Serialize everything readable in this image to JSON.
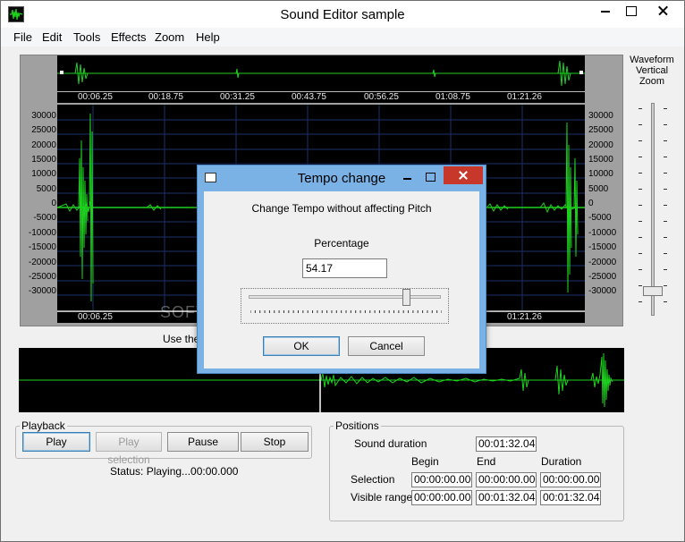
{
  "window": {
    "title": "Sound Editor sample",
    "icon": "waveform-icon"
  },
  "menu": [
    "File",
    "Edit",
    "Tools",
    "Effects",
    "Zoom",
    "Help"
  ],
  "ruler": [
    "00:06.25",
    "00:18.75",
    "00:31.25",
    "00:43.75",
    "00:56.25",
    "01:08.75",
    "01:21.26"
  ],
  "y_axis": [
    "30000",
    "25000",
    "20000",
    "15000",
    "10000",
    "5000",
    "0",
    "-5000",
    "-10000",
    "-15000",
    "-20000",
    "-25000",
    "-30000"
  ],
  "zoom": {
    "label_line1": "Waveform",
    "label_line2": "Vertical",
    "label_line3": "Zoom"
  },
  "hint_text": "Use the",
  "playback": {
    "legend": "Playback",
    "play": "Play",
    "play_selection": "Play selection",
    "pause": "Pause",
    "stop": "Stop",
    "status": "Status: Playing...00:00.000"
  },
  "positions": {
    "legend": "Positions",
    "sound_duration_label": "Sound duration",
    "sound_duration": "00:01:32.043",
    "col_begin": "Begin",
    "col_end": "End",
    "col_duration": "Duration",
    "selection_label": "Selection",
    "selection": [
      "00:00:00.000",
      "00:00:00.000",
      "00:00:00.000"
    ],
    "visible_label": "Visible range",
    "visible": [
      "00:00:00.000",
      "00:01:32.043",
      "00:01:32.043"
    ]
  },
  "dialog": {
    "title": "Tempo change",
    "heading": "Change Tempo without affecting Pitch",
    "percentage_label": "Percentage",
    "percentage_value": "54.17",
    "slider_level": 0.82,
    "ok": "OK",
    "cancel": "Cancel"
  },
  "watermark": "SOFTPEDIA",
  "colors": {
    "wave": "#1fd11f",
    "dialog_frame": "#7ab2e6",
    "close": "#c7382b"
  }
}
